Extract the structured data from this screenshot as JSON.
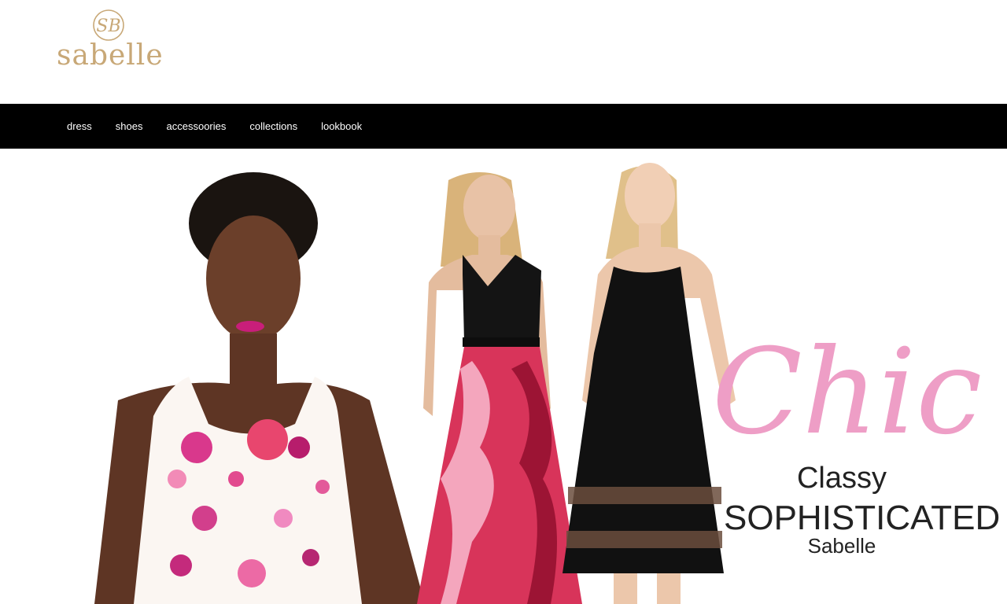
{
  "brand": {
    "monogram": "SB",
    "name": "sabelle",
    "color": "#c8a877"
  },
  "nav": {
    "items": [
      {
        "label": "dress"
      },
      {
        "label": "shoes"
      },
      {
        "label": "accessoories"
      },
      {
        "label": "collections"
      },
      {
        "label": "lookbook"
      }
    ]
  },
  "hero": {
    "script_text": "Chic",
    "line1": "Classy",
    "line2": "SOPHISTICATED",
    "line3": "Sabelle",
    "script_color": "#ee9ec6"
  }
}
